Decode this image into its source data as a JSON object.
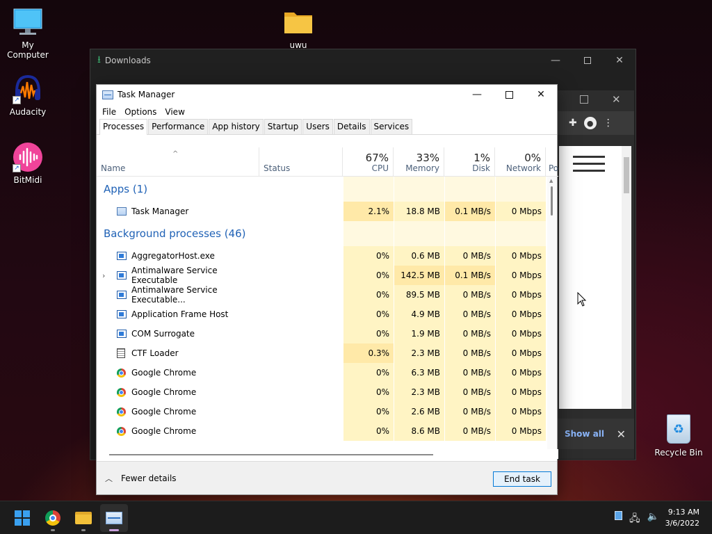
{
  "desktop": {
    "icons": [
      {
        "label": "My Computer"
      },
      {
        "label": "Audacity"
      },
      {
        "label": "BitMidi"
      },
      {
        "label": "uwu"
      },
      {
        "label": "Recycle Bin"
      }
    ]
  },
  "downloads_window": {
    "title": "Downloads"
  },
  "chrome_window": {
    "download_bar": {
      "show_all": "Show all"
    }
  },
  "task_manager": {
    "title": "Task Manager",
    "menu": [
      "File",
      "Options",
      "View"
    ],
    "tabs": [
      "Processes",
      "Performance",
      "App history",
      "Startup",
      "Users",
      "Details",
      "Services"
    ],
    "active_tab": "Processes",
    "columns": {
      "name": "Name",
      "status": "Status",
      "cpu": {
        "pct": "67%",
        "label": "CPU"
      },
      "memory": {
        "pct": "33%",
        "label": "Memory"
      },
      "disk": {
        "pct": "1%",
        "label": "Disk"
      },
      "network": {
        "pct": "0%",
        "label": "Network"
      },
      "power": "Po"
    },
    "groups": {
      "apps": "Apps (1)",
      "background": "Background processes (46)"
    },
    "apps": [
      {
        "name": "Task Manager",
        "cpu": "2.1%",
        "memory": "18.8 MB",
        "disk": "0.1 MB/s",
        "network": "0 Mbps",
        "icon": "task-manager-icon"
      }
    ],
    "background": [
      {
        "name": "AggregatorHost.exe",
        "cpu": "0%",
        "memory": "0.6 MB",
        "disk": "0 MB/s",
        "network": "0 Mbps",
        "icon": "service-icon"
      },
      {
        "name": "Antimalware Service Executable",
        "cpu": "0%",
        "memory": "142.5 MB",
        "disk": "0.1 MB/s",
        "network": "0 Mbps",
        "icon": "service-icon"
      },
      {
        "name": "Antimalware Service Executable...",
        "cpu": "0%",
        "memory": "89.5 MB",
        "disk": "0 MB/s",
        "network": "0 Mbps",
        "icon": "service-icon"
      },
      {
        "name": "Application Frame Host",
        "cpu": "0%",
        "memory": "4.9 MB",
        "disk": "0 MB/s",
        "network": "0 Mbps",
        "icon": "service-icon"
      },
      {
        "name": "COM Surrogate",
        "cpu": "0%",
        "memory": "1.9 MB",
        "disk": "0 MB/s",
        "network": "0 Mbps",
        "icon": "service-icon"
      },
      {
        "name": "CTF Loader",
        "cpu": "0.3%",
        "memory": "2.3 MB",
        "disk": "0 MB/s",
        "network": "0 Mbps",
        "icon": "ctf-icon"
      },
      {
        "name": "Google Chrome",
        "cpu": "0%",
        "memory": "6.3 MB",
        "disk": "0 MB/s",
        "network": "0 Mbps",
        "icon": "chrome-icon"
      },
      {
        "name": "Google Chrome",
        "cpu": "0%",
        "memory": "2.3 MB",
        "disk": "0 MB/s",
        "network": "0 Mbps",
        "icon": "chrome-icon"
      },
      {
        "name": "Google Chrome",
        "cpu": "0%",
        "memory": "2.6 MB",
        "disk": "0 MB/s",
        "network": "0 Mbps",
        "icon": "chrome-icon"
      },
      {
        "name": "Google Chrome",
        "cpu": "0%",
        "memory": "8.6 MB",
        "disk": "0 MB/s",
        "network": "0 Mbps",
        "icon": "chrome-icon"
      }
    ],
    "footer": {
      "fewer_details": "Fewer details",
      "end_task": "End task"
    }
  },
  "taskbar": {
    "clock": {
      "time": "9:13 AM",
      "date": "3/6/2022"
    }
  }
}
